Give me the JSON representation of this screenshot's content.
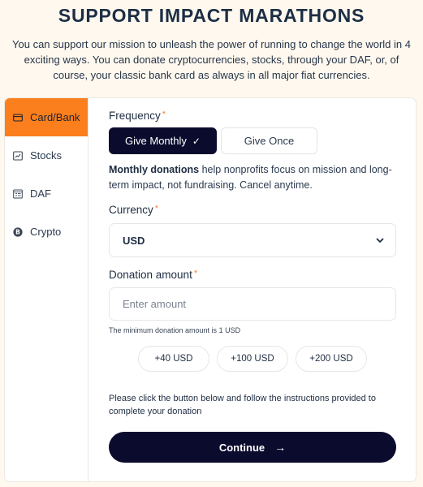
{
  "header": {
    "title": "SUPPORT IMPACT MARATHONS",
    "intro": "You can support our mission to unleash the power of running to change the world in 4 exciting ways. You can donate cryptocurrencies, stocks, through your DAF, or, of course, your classic bank card as always in all major fiat currencies."
  },
  "sidebar": {
    "items": [
      {
        "label": "Card/Bank",
        "icon": "credit-card-icon",
        "active": true
      },
      {
        "label": "Stocks",
        "icon": "stock-chart-icon",
        "active": false
      },
      {
        "label": "DAF",
        "icon": "daf-document-icon",
        "active": false
      },
      {
        "label": "Crypto",
        "icon": "bitcoin-icon",
        "active": false
      }
    ]
  },
  "form": {
    "frequency": {
      "label": "Frequency",
      "required_mark": "*",
      "options": [
        {
          "label": "Give Monthly",
          "selected": true,
          "check": "✓"
        },
        {
          "label": "Give Once",
          "selected": false
        }
      ]
    },
    "description": {
      "bold": "Monthly donations",
      "rest": " help nonprofits focus on mission and long-term impact, not fundraising. Cancel anytime."
    },
    "currency": {
      "label": "Currency",
      "required_mark": "*",
      "value": "USD"
    },
    "amount": {
      "label": "Donation amount",
      "required_mark": "*",
      "value": "",
      "placeholder": "Enter amount",
      "hint": "The minimum donation amount is 1 USD"
    },
    "presets": [
      "+40 USD",
      "+100 USD",
      "+200 USD"
    ],
    "instructions": "Please click the button below and follow the instructions provided to complete your donation",
    "continue_label": "Continue",
    "continue_arrow": "→"
  },
  "colors": {
    "accent_orange": "#fb7f1c",
    "primary_navy": "#0b0b2e",
    "background": "#fff8ee"
  }
}
